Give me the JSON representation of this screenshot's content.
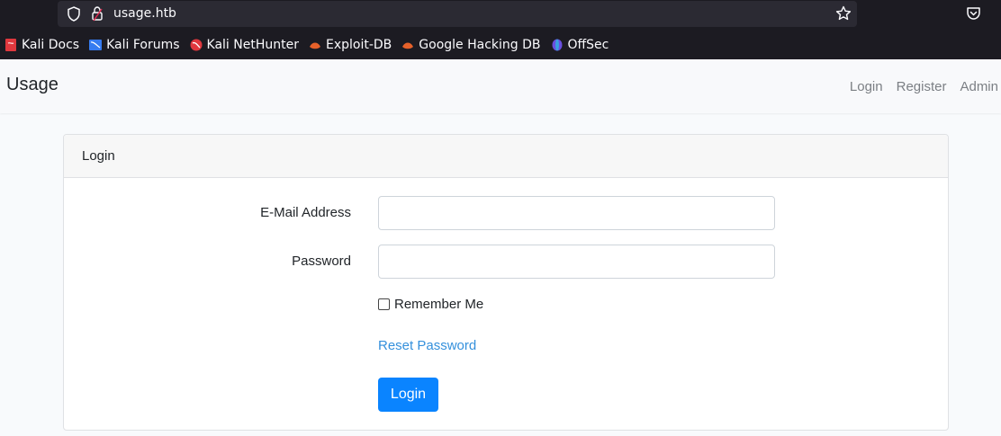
{
  "browser": {
    "url": "usage.htb",
    "bookmarks": [
      {
        "label": "Kali Docs",
        "icon": "kali-docs-icon",
        "color": "#e0383e"
      },
      {
        "label": "Kali Forums",
        "icon": "kali-forums-icon",
        "color": "#367bf0"
      },
      {
        "label": "Kali NetHunter",
        "icon": "kali-nethunter-icon",
        "color": "#e0383e"
      },
      {
        "label": "Exploit-DB",
        "icon": "exploit-db-icon",
        "color": "#e6612a"
      },
      {
        "label": "Google Hacking DB",
        "icon": "ghdb-icon",
        "color": "#e6612a"
      },
      {
        "label": "OffSec",
        "icon": "offsec-icon",
        "color": "#6a4fe0"
      }
    ]
  },
  "navbar": {
    "brand": "Usage",
    "links": [
      "Login",
      "Register",
      "Admin"
    ]
  },
  "card": {
    "header": "Login",
    "email_label": "E-Mail Address",
    "email_value": "",
    "password_label": "Password",
    "password_value": "",
    "remember_label": "Remember Me",
    "reset_label": "Reset Password",
    "submit_label": "Login"
  }
}
